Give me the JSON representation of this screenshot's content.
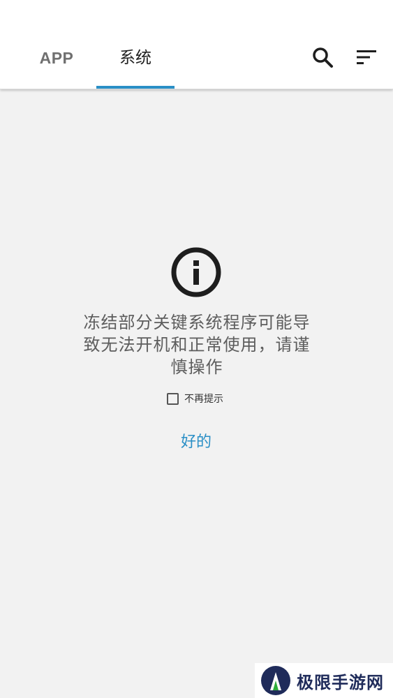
{
  "tabs": [
    {
      "label": "APP",
      "selected": false
    },
    {
      "label": "系统",
      "selected": true
    }
  ],
  "toolbar": {
    "search_icon": "search-icon",
    "sort_icon": "sort-icon"
  },
  "dialog": {
    "icon": "info-icon",
    "message": "冻结部分关键系统程序可能导致无法开机和正常使用，请谨慎操作",
    "checkbox_label": "不再提示",
    "checkbox_checked": false,
    "ok_label": "好的"
  },
  "watermark": {
    "text": "极限手游网"
  },
  "colors": {
    "accent": "#2a8fc6",
    "background": "#f2f2f2",
    "appbar": "#ffffff",
    "message_text": "#5d5d5d"
  }
}
